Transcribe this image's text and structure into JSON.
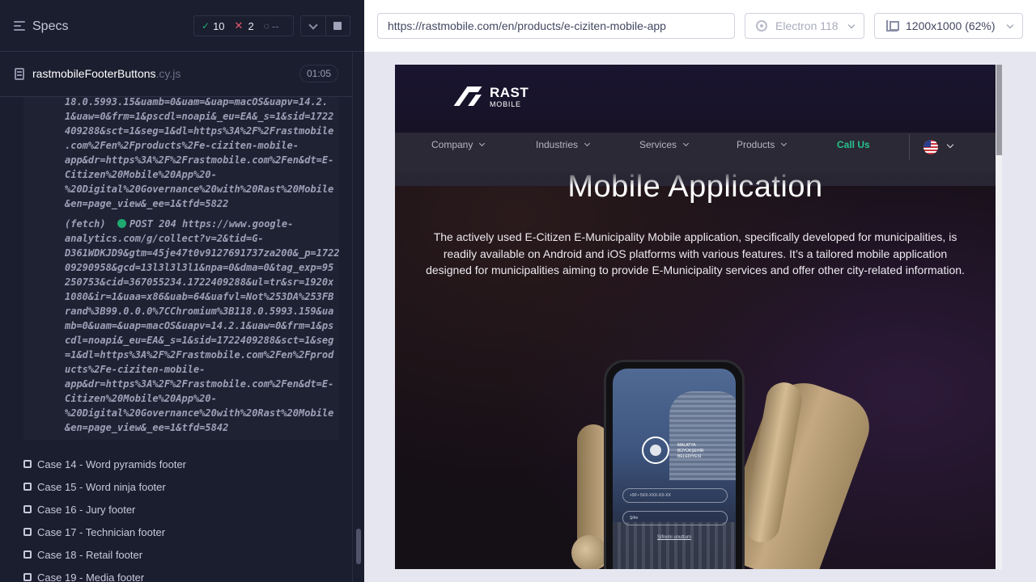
{
  "runner": {
    "title": "Specs",
    "stats": {
      "passed": "10",
      "failed": "2",
      "pending": "--"
    },
    "spec": {
      "name": "rastmobileFooterButtons",
      "ext": ".cy.js",
      "time": "01:05"
    },
    "log": {
      "block1": "18.0.5993.15&uamb=0&uam=&uap=macOS&uapv=14.2.\n1&uaw=0&frm=1&pscdl=noapi&_eu=EA&_s=1&sid=1722\n409288&sct=1&seg=1&dl=https%3A%2F%2Frastmobile\n.com%2Fen%2Fproducts%2Fe-ciziten-mobile-\napp&dr=https%3A%2F%2Frastmobile.com%2Fen&dt=E-\nCitizen%20Mobile%20App%20-\n%20Digital%20Governance%20with%20Rast%20Mobile\n&en=page_view&_ee=1&tfd=5822",
      "fetch_prefix": "(fetch)  ",
      "fetch_first": "POST 204 https://www.google-",
      "block2": "analytics.com/g/collect?v=2&tid=G-\nD361WDKJD9&gtm=45je47t0v9127691737za200&_p=17224\n09290958&gcd=13l3l3l3l1&npa=0&dma=0&tag_exp=95\n250753&cid=367055234.1722409288&ul=tr&sr=1920x\n1080&ir=1&uaa=x86&uab=64&uafvl=Not%253DA%253FB\nrand%3B99.0.0.0%7CChromium%3B118.0.5993.159&ua\nmb=0&uam=&uap=macOS&uapv=14.2.1&uaw=0&frm=1&ps\ncdl=noapi&_eu=EA&_s=1&sid=1722409288&sct=1&seg\n=1&dl=https%3A%2F%2Frastmobile.com%2Fen%2Fprod\nucts%2Fe-ciziten-mobile-\napp&dr=https%3A%2F%2Frastmobile.com%2Fen&dt=E-\nCitizen%20Mobile%20App%20-\n%20Digital%20Governance%20with%20Rast%20Mobile\n&en=page_view&_ee=1&tfd=5842"
    },
    "cases": [
      "Case 14 - Word pyramids footer",
      "Case 15 - Word ninja footer",
      "Case 16 - Jury footer",
      "Case 17 - Technician footer",
      "Case 18 - Retail footer",
      "Case 19 - Media footer"
    ]
  },
  "aut": {
    "url": "https://rastmobile.com/en/products/e-ciziten-mobile-app",
    "browser": "Electron 118",
    "viewport": "1200x1000",
    "zoom": "(62%)"
  },
  "site": {
    "logo_top": "RAST",
    "logo_bottom": "MOBILE",
    "nav": [
      "Company",
      "Industries",
      "Services",
      "Products"
    ],
    "call_us": "Call Us",
    "hero_title": "Mobile Application",
    "hero_desc": "The actively used E-Citizen E-Municipality Mobile application, specifically developed for municipalities, is readily available on Android and iOS platforms with various features. It’s a tailored mobile application designed for municipalities aiming to provide E-Municipality services and offer other city-related information.",
    "phone_org": "MALATYA\nBÜYÜKŞEHİR\nBELEDİYESİ",
    "phone_prefix": "+90 •   5XX-XXX-XX-XX",
    "phone_pass": "Şifre",
    "phone_forgot": "Şifremi unuttum"
  },
  "colors": {
    "pass": "#1fa971",
    "fail": "#e45770",
    "call_us": "#25c28b",
    "panel_bg": "#1b1e2e"
  }
}
